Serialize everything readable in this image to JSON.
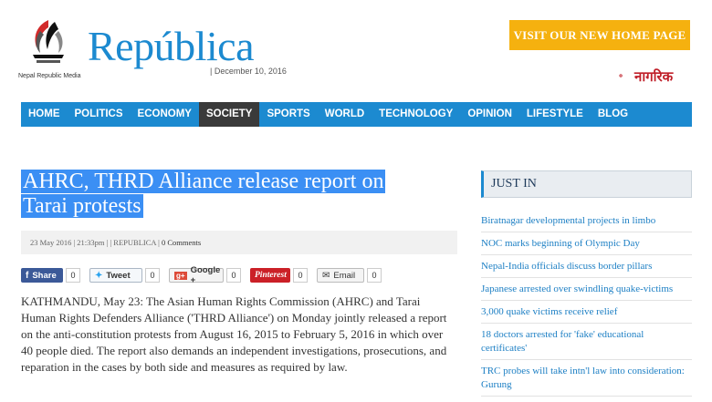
{
  "header": {
    "logo_text": "República",
    "logo_subtitle": "Nepal Republic Media",
    "dateline": "| December 10, 2016",
    "visit_button": "VISIT OUR NEW HOME PAGE",
    "partner_logo": "नागरिक"
  },
  "nav": {
    "items": [
      "HOME",
      "POLITICS",
      "ECONOMY",
      "SOCIETY",
      "SPORTS",
      "WORLD",
      "TECHNOLOGY",
      "OPINION",
      "LIFESTYLE",
      "BLOG"
    ],
    "active": "SOCIETY"
  },
  "article": {
    "title_line1": "AHRC, THRD Alliance release report on",
    "title_line2": "Tarai protests",
    "meta_date": "23 May 2016 | 21:33pm |",
    "meta_source": "|  REPUBLICA  |",
    "meta_comments": "0 Comments",
    "body": "KATHMANDU, May 23: The Asian Human Rights Commission (AHRC) and Tarai Human Rights Defenders Alliance ('THRD Alliance') on Monday jointly released a report on the anti-constitution protests from August 16, 2015 to February 5, 2016 in which over 40 people died. The report also demands an independent investigations, prosecutions, and reparation in the cases by both side and measures as required by law."
  },
  "share": {
    "facebook": {
      "label": "Share",
      "count": "0"
    },
    "twitter": {
      "label": "Tweet",
      "count": "0"
    },
    "google": {
      "label": "Google +",
      "count": "0"
    },
    "pinterest": {
      "label": "Pinterest",
      "count": "0"
    },
    "email": {
      "label": "Email",
      "count": "0"
    }
  },
  "sidebar": {
    "heading": "JUST IN",
    "items": [
      "Biratnagar developmental projects in limbo",
      "NOC marks beginning of Olympic Day",
      "Nepal-India officials discuss border pillars",
      "Japanese arrested over swindling quake-victims",
      "3,000 quake victims receive relief",
      "18 doctors arrested for 'fake' educational certificates'",
      "TRC probes will take intn'l law into consideration: Gurung"
    ]
  },
  "colors": {
    "brand_blue": "#1c8ad0",
    "visit_orange": "#f5b10f",
    "title_highlight": "#3b8ff4"
  }
}
